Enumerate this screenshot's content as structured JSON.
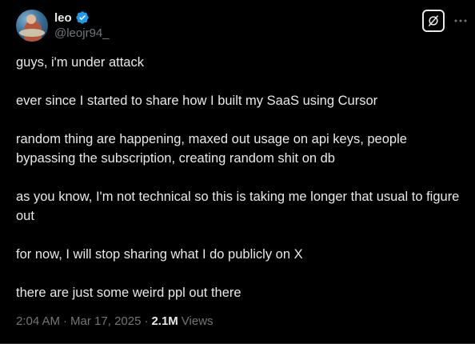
{
  "author": {
    "display_name": "leo",
    "handle": "@leojr94_",
    "verified": true
  },
  "colors": {
    "background": "#000000",
    "text_primary": "#e7e9ea",
    "text_secondary": "#71767b",
    "verified_badge": "#1d9bf0"
  },
  "icons": {
    "verified": "verified-badge-icon",
    "grok": "grok-icon",
    "more": "more-options-icon"
  },
  "tweet": {
    "paragraphs": [
      "guys, i'm under attack",
      "ever since I started to share how I built my SaaS using Cursor",
      "random thing are happening, maxed out usage on api keys, people bypassing the subscription, creating random shit on db",
      "as you know, I'm not technical so this is taking me longer that usual to figure out",
      "for now, I will stop sharing what I do publicly on X",
      "there are just some weird ppl out there"
    ],
    "time": "2:04 AM",
    "date": "Mar 17, 2025",
    "views_count": "2.1M",
    "views_label": "Views",
    "separator": "·"
  }
}
